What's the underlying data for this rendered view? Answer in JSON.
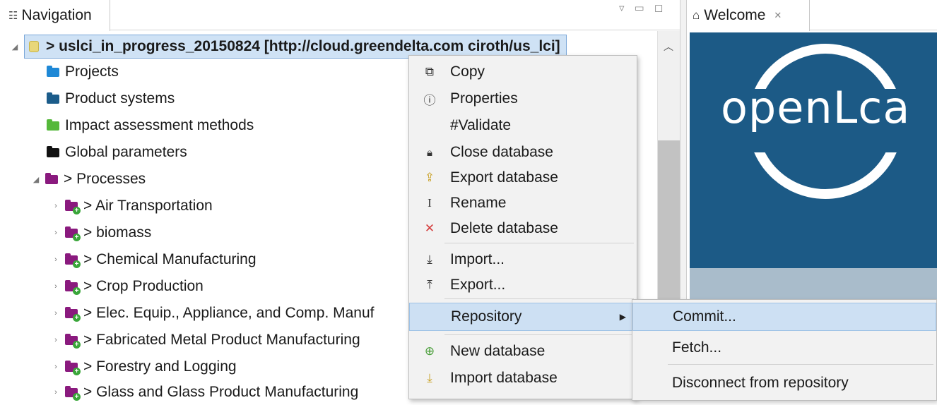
{
  "navigation": {
    "tab_label": "Navigation",
    "root": {
      "label": "> uslci_in_progress_20150824 [http://cloud.greendelta.com ciroth/us_lci]"
    },
    "items": [
      {
        "label": "Projects",
        "color": "#1e88d6"
      },
      {
        "label": "Product systems",
        "color": "#1b5c8a"
      },
      {
        "label": "Impact assessment methods",
        "color": "#55b83a"
      },
      {
        "label": "Global parameters",
        "color": "#111111"
      },
      {
        "label": "> Processes",
        "color": "#8a1a7e"
      }
    ],
    "process_children": [
      {
        "label": "> Air Transportation"
      },
      {
        "label": "> biomass"
      },
      {
        "label": "> Chemical Manufacturing"
      },
      {
        "label": "> Crop Production"
      },
      {
        "label": "> Elec. Equip., Appliance, and Comp. Manuf"
      },
      {
        "label": "> Fabricated Metal Product Manufacturing"
      },
      {
        "label": "> Forestry and Logging"
      },
      {
        "label": "> Glass and Glass Product Manufacturing"
      }
    ]
  },
  "welcome": {
    "tab_label": "Welcome",
    "logo_text": "openLca"
  },
  "context_menu": {
    "items": [
      {
        "label": "Copy",
        "icon": "copy-icon",
        "glyph": "⧉"
      },
      {
        "label": "Properties",
        "icon": "info-icon",
        "glyph": "ⓘ"
      },
      {
        "label": "#Validate",
        "icon": "",
        "glyph": ""
      },
      {
        "label": "Close database",
        "icon": "lock-icon",
        "glyph": "🔒"
      },
      {
        "label": "Export database",
        "icon": "export-db-icon",
        "glyph": "⇪"
      },
      {
        "label": "Rename",
        "icon": "rename-icon",
        "glyph": "I"
      },
      {
        "label": "Delete database",
        "icon": "delete-icon",
        "glyph": "✕"
      },
      {
        "label": "Import...",
        "icon": "import-icon",
        "glyph": "⤓"
      },
      {
        "label": "Export...",
        "icon": "export-icon",
        "glyph": "⤒"
      },
      {
        "label": "Repository",
        "icon": "",
        "glyph": ""
      },
      {
        "label": "New database",
        "icon": "new-db-icon",
        "glyph": "⊕"
      },
      {
        "label": "Import database",
        "icon": "import-db-icon",
        "glyph": "⤓"
      }
    ]
  },
  "repository_submenu": {
    "items": [
      {
        "label": "Commit..."
      },
      {
        "label": "Fetch..."
      },
      {
        "label": "Disconnect from repository"
      }
    ]
  },
  "colors": {
    "selection": "#cde0f3",
    "banner": "#1c5a86",
    "delete_icon": "#d43c3c",
    "db_icon": "#e8d77a"
  }
}
